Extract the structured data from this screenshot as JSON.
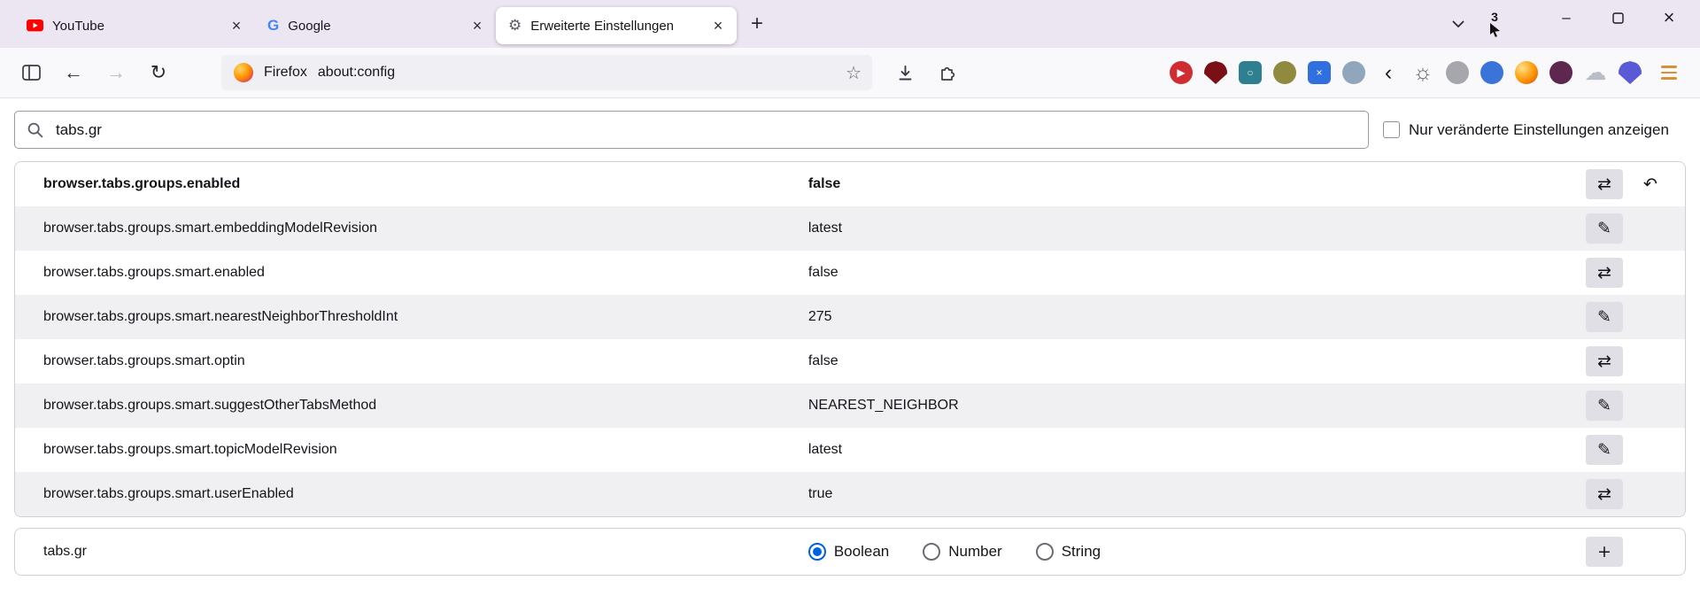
{
  "tabbar": {
    "tabs": [
      {
        "label": "YouTube"
      },
      {
        "label": "Google"
      },
      {
        "label": "Erweiterte Einstellungen"
      }
    ],
    "badge_count": "3"
  },
  "toolbar": {
    "identity_label": "Firefox",
    "url": "about:config",
    "extensions": [
      {
        "name": "video-downloader-icon",
        "color": "#cf2d32",
        "inner": "▶",
        "inner_color": "#ffffff"
      },
      {
        "name": "ublock-origin-shield-icon",
        "color": "#7a1016",
        "shape": "shield"
      },
      {
        "name": "screenshot-tool-icon",
        "color": "#2e7f8f",
        "shape": "square",
        "inner": "○",
        "inner_color": "#e8f2f4"
      },
      {
        "name": "olive-ball-extension-icon",
        "color": "#8f8a3e"
      },
      {
        "name": "dice-extension-icon",
        "color": "#2f6fde",
        "shape": "square",
        "inner": "×",
        "inner_color": "#ffffff"
      },
      {
        "name": "muted-blue-extension-icon",
        "color": "#8fa6bd"
      },
      {
        "name": "chevron-left-extension-icon",
        "glyph": "‹",
        "color": "#1a1a1f"
      },
      {
        "name": "sun-settings-extension-icon",
        "glyph": "☼",
        "color": "#5b5b66"
      },
      {
        "name": "gray-blob-extension-icon",
        "color": "#a6a6ad"
      },
      {
        "name": "blue-wave-extension-icon",
        "color": "#3b74d9"
      },
      {
        "name": "firefox-globe-icon",
        "color": "#ff9500",
        "gradient": true
      },
      {
        "name": "maroon-extension-icon",
        "color": "#5e2750"
      },
      {
        "name": "cloud-extension-icon",
        "glyph": "☁",
        "color": "#b9bec6"
      },
      {
        "name": "purple-shield-extension-icon",
        "color": "#5a5ad6",
        "shape": "shield"
      }
    ]
  },
  "page": {
    "search_value": "tabs.gr",
    "show_modified_only_label": "Nur veränderte Einstellungen anzeigen",
    "prefs": [
      {
        "name": "browser.tabs.groups.enabled",
        "value": "false"
      },
      {
        "name": "browser.tabs.groups.smart.embeddingModelRevision",
        "value": "latest"
      },
      {
        "name": "browser.tabs.groups.smart.enabled",
        "value": "false"
      },
      {
        "name": "browser.tabs.groups.smart.nearestNeighborThresholdInt",
        "value": "275"
      },
      {
        "name": "browser.tabs.groups.smart.optin",
        "value": "false"
      },
      {
        "name": "browser.tabs.groups.smart.suggestOtherTabsMethod",
        "value": "NEAREST_NEIGHBOR"
      },
      {
        "name": "browser.tabs.groups.smart.topicModelRevision",
        "value": "latest"
      },
      {
        "name": "browser.tabs.groups.smart.userEnabled",
        "value": "true"
      }
    ],
    "add": {
      "name": "tabs.gr",
      "type_options": [
        "Boolean",
        "Number",
        "String"
      ],
      "selected_type": "Boolean"
    }
  },
  "colors": {
    "accent": "#0061e0",
    "tabbar_bg": "#ece6f3"
  }
}
